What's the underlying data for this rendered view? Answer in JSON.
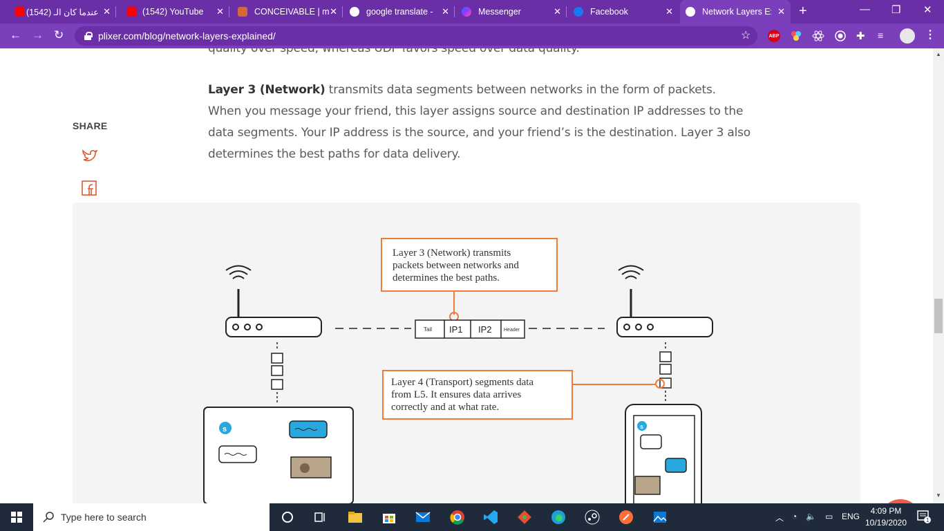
{
  "browser": {
    "tabs": [
      {
        "label": "(1542) عندما كان الـ",
        "favicon": "youtube-icon",
        "color": "#ff0000"
      },
      {
        "label": "(1542) YouTube",
        "favicon": "youtube-icon",
        "color": "#ff0000"
      },
      {
        "label": "CONCEIVABLE | m",
        "favicon": "conceivable-icon",
        "color": "#c0392b"
      },
      {
        "label": "google translate -",
        "favicon": "google-icon",
        "color": "#ffffff"
      },
      {
        "label": "Messenger",
        "favicon": "messenger-icon",
        "color": "#8e44ff"
      },
      {
        "label": "Facebook",
        "favicon": "facebook-icon",
        "color": "#1877f2"
      },
      {
        "label": "Network Layers Ex",
        "favicon": "plixer-icon",
        "color": "#ffffff"
      }
    ],
    "url": "plixer.com/blog/network-layers-explained/",
    "accent": "#7b3fbb",
    "abp_label": "ABP"
  },
  "article": {
    "cut_line": "quality over speed, whereas UDP favors speed over data quality.",
    "layer3_bold": "Layer 3 (Network)",
    "layer3_l1": " transmits data segments between networks in the form of packets.",
    "layer3_l2": "When you message your friend, this layer assigns source and destination IP addresses to the",
    "layer3_l3": "data segments. Your IP address is the source, and your friend’s is the destination. Layer 3 also",
    "layer3_l4": "determines the best paths for data delivery."
  },
  "share": {
    "label": "SHARE"
  },
  "diagram": {
    "callout_top": [
      "Layer 3 (Network) transmits",
      "packets between networks and",
      "determines the best paths."
    ],
    "callout_mid": [
      "Layer 4 (Transport) segments data",
      "from L5. It ensures data arrives",
      "correctly and at what rate."
    ],
    "packet": {
      "tail": "Tail",
      "ip1": "IP1",
      "ip2": "IP2",
      "header": "Header"
    },
    "accent": "#f07a3a"
  },
  "taskbar": {
    "search_placeholder": "Type here to search",
    "lang": "ENG",
    "time": "4:09 PM",
    "date": "10/19/2020",
    "notif_count": "1"
  }
}
